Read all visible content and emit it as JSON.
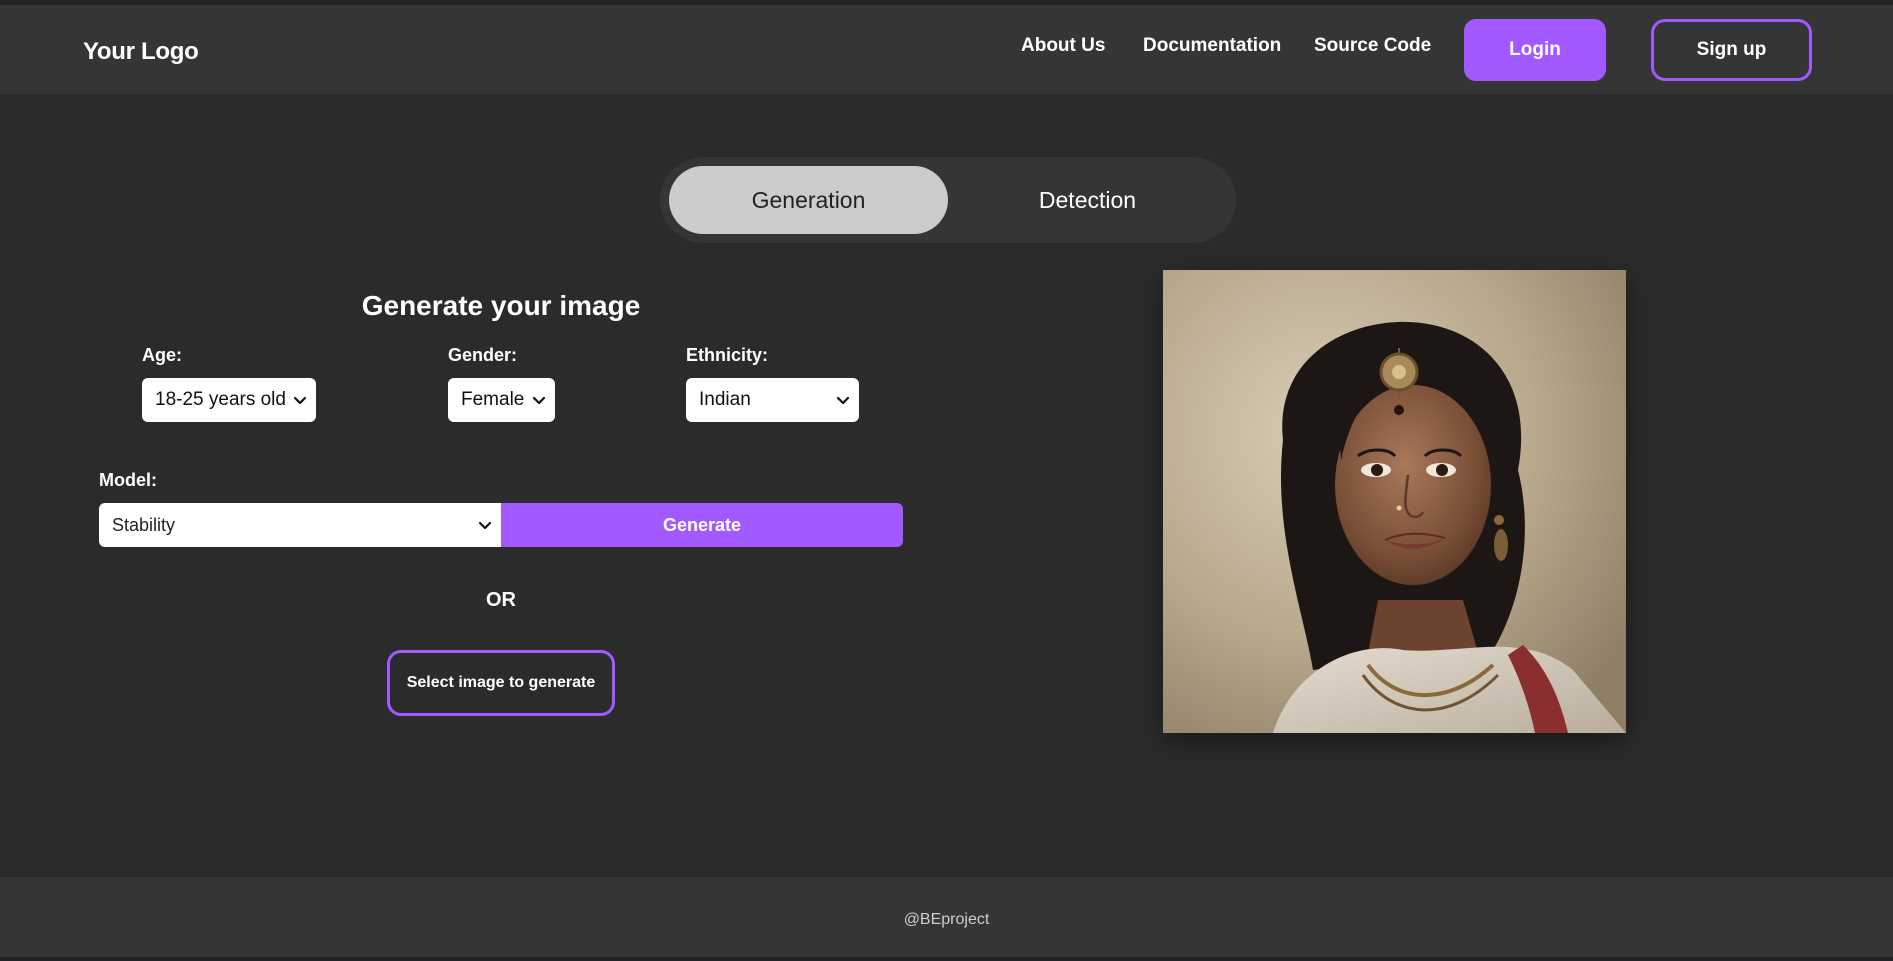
{
  "header": {
    "logo": "Your Logo",
    "nav": {
      "about": "About Us",
      "documentation": "Documentation",
      "source_code": "Source Code"
    },
    "login_label": "Login",
    "signup_label": "Sign up"
  },
  "tabs": [
    {
      "label": "Generation",
      "active": true
    },
    {
      "label": "Detection",
      "active": false
    }
  ],
  "form": {
    "title": "Generate your image",
    "age": {
      "label": "Age:",
      "value": "18-25 years old"
    },
    "gender": {
      "label": "Gender:",
      "value": "Female"
    },
    "ethnicity": {
      "label": "Ethnicity:",
      "value": "Indian"
    },
    "model": {
      "label": "Model:",
      "value": "Stability"
    },
    "generate_label": "Generate",
    "or_text": "OR",
    "select_image_label": "Select image to generate"
  },
  "footer": {
    "text": "@BEproject"
  },
  "colors": {
    "accent": "#a259ff",
    "background": "#2b2b2b",
    "header_bg": "#353535",
    "active_tab_bg": "#cccccc"
  },
  "icons": {
    "select_chevron": "chevron-down-icon"
  }
}
